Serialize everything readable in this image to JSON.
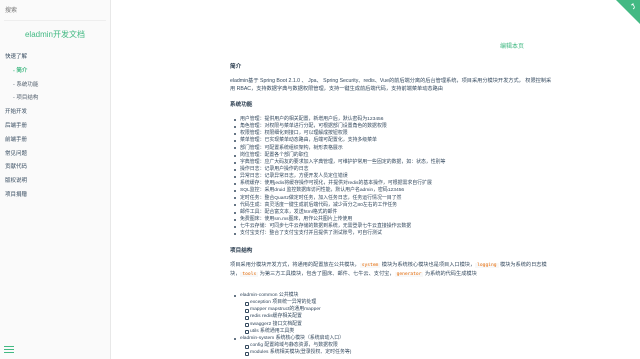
{
  "sidebar": {
    "search_placeholder": "搜索",
    "app_name": "eladmin开发文档",
    "items": [
      {
        "label": "快速了解",
        "level": 0,
        "active": false
      },
      {
        "label": "- 简介",
        "level": 1,
        "active": true
      },
      {
        "label": "- 系统功能",
        "level": 1,
        "active": false
      },
      {
        "label": "- 项目结构",
        "level": 1,
        "active": false
      },
      {
        "label": "开始开发",
        "level": 0,
        "active": false
      },
      {
        "label": "后端手册",
        "level": 0,
        "active": false
      },
      {
        "label": "前端手册",
        "level": 0,
        "active": false
      },
      {
        "label": "常见问题",
        "level": 0,
        "active": false
      },
      {
        "label": "贡献代码",
        "level": 0,
        "active": false
      },
      {
        "label": "版权说明",
        "level": 0,
        "active": false
      },
      {
        "label": "项目捐赠",
        "level": 0,
        "active": false
      }
    ]
  },
  "main": {
    "edit_link": "编辑本页",
    "intro_heading": "简介",
    "intro_text": "eladmin基于 Spring Boot 2.1.0 、 Jpa、 Spring Security、redis、Vue的前后端分离的后台管理系统，项目采用分模块开发方式， 权限控制采用 RBAC，支持数据字典与数据权限管理，支持一键生成前后端代码，支持前端菜单动态路由",
    "features_heading": "系统功能",
    "features": [
      "用户管理：提供用户的相关配置，新增用户后，默认密码为123456",
      "角色管理：对权限与菜单进行分配，可根据部门设置角色的数据权限",
      "权限管理：权限细化到接口，可以理解成按钮权限",
      "菜单管理：已实现菜单动态路由，后端可配置化，支持多级菜单",
      "部门管理：可配置系统组织架构，树形表格展示",
      "岗位管理：配置各个部门的职位",
      "字典管理：应广大码友的要求加入字典管理，可维护护常用一些固定的数据，如：状态，性别等",
      "操作日志：记录用户操作的日志",
      "异常日志：记录异常日志，方便开发人员定位错误",
      "系统缓存：使用jedis将缓存操作可视化，并提供对redis的基本操作，可根据需求自行扩展",
      "SQL监控：采用druid 监控数据库访问性能，默认用户名admin，密码123456",
      "定时任务：整合Quartz做定时任务，加入任务日志，任务运行情况一目了然",
      "代码生成：高灵活度一键生成前后端代码，减少百分之80左右的工作任务",
      "邮件工具：配合富文本，发送html格式的邮件",
      "免费图床：使用sm.ms图床，用作公共图片上传使用",
      "七牛云存储：可同步七牛云存储的数据到系统，无需登录七牛云直接操作云数据",
      "支付宝支付：整合了支付宝支付并且提供了测试账号，可自行测试"
    ],
    "structure_heading": "项目结构",
    "structure_text_1": "项目采用分模块开发方式，将通用的配置放在公共模块，",
    "structure_code_1": "system",
    "structure_text_2": " 模块为系统核心模块也是项目入口模块，",
    "structure_code_2": "logging",
    "structure_text_3": " 模块为系统的日志模块，",
    "structure_code_3": "tools",
    "structure_text_4": " 为第三方工具模块，包含了图床、邮件、七牛云、支付宝，",
    "structure_code_4": "generator",
    "structure_text_5": " 为系统的代码生成模块",
    "tree": [
      {
        "label": "eladmin-common 公共模块",
        "level": 1
      },
      {
        "label": "exception 项目统一异常的处理",
        "level": 2
      },
      {
        "label": "mapper mapstruct的通用mapper",
        "level": 2
      },
      {
        "label": "redis redis缓存相关配置",
        "level": 2
      },
      {
        "label": "swagger2 接口文档配置",
        "level": 2
      },
      {
        "label": "utils 系统通用工具类",
        "level": 2
      },
      {
        "label": "eladmin-system 系统核心模块（系统启动入口）",
        "level": 1
      },
      {
        "label": "config 配置跨域与静态资源，与数据权限",
        "level": 2
      },
      {
        "label": "modules 系统相关模块(登录授权、定时任务等)",
        "level": 2
      }
    ]
  },
  "colors": {
    "accent": "#42b983",
    "text": "#34495e",
    "sidebar_bg": "#fafafa",
    "code": "#e96900"
  },
  "icons": {
    "sidebar_toggle": "hamburger-icon",
    "corner": "github-corner-icon"
  }
}
